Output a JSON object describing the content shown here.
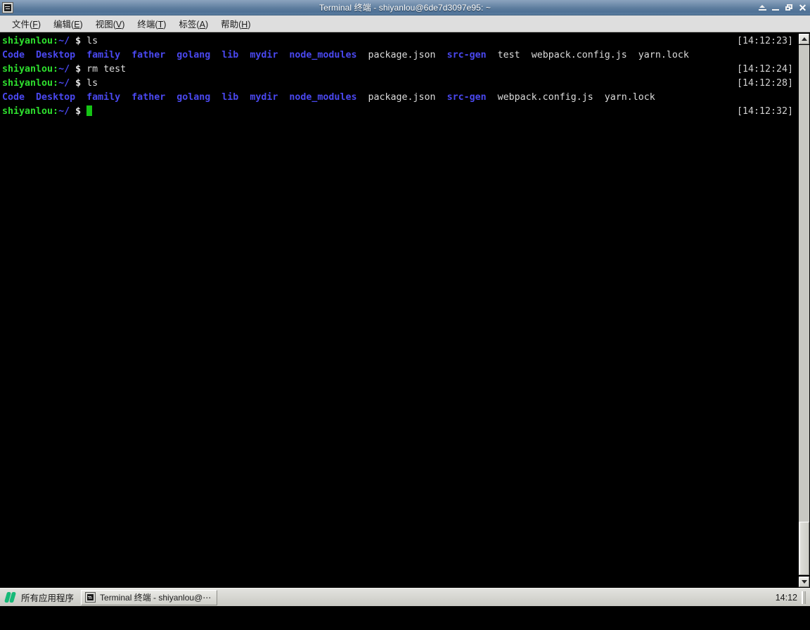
{
  "window": {
    "title": "Terminal 终端 - shiyanlou@6de7d3097e95: ~",
    "icon": "terminal-icon",
    "buttons": {
      "shade": "shade-window",
      "minimize": "minimize-window",
      "maximize": "maximize-window",
      "close": "✕"
    }
  },
  "menubar": {
    "items": [
      {
        "label": "文件",
        "accel": "F"
      },
      {
        "label": "编辑",
        "accel": "E"
      },
      {
        "label": "视图",
        "accel": "V"
      },
      {
        "label": "终端",
        "accel": "T"
      },
      {
        "label": "标签",
        "accel": "A"
      },
      {
        "label": "帮助",
        "accel": "H"
      }
    ]
  },
  "terminal": {
    "prompt_user": "shiyanlou:",
    "prompt_path": "~/",
    "prompt_sign": "$",
    "colors": {
      "background": "#000000",
      "green": "#2ee02e",
      "blue": "#4a48f0",
      "white": "#dcdcdc",
      "cursor": "#15c415"
    },
    "lines": [
      {
        "type": "command",
        "command": "ls",
        "timestamp": "[14:12:23]"
      },
      {
        "type": "output",
        "entries": [
          {
            "name": "Code",
            "kind": "dir"
          },
          {
            "name": "Desktop",
            "kind": "dir"
          },
          {
            "name": "family",
            "kind": "dir"
          },
          {
            "name": "father",
            "kind": "dir"
          },
          {
            "name": "golang",
            "kind": "dir"
          },
          {
            "name": "lib",
            "kind": "dir"
          },
          {
            "name": "mydir",
            "kind": "dir"
          },
          {
            "name": "node_modules",
            "kind": "dir"
          },
          {
            "name": "package.json",
            "kind": "file"
          },
          {
            "name": "src-gen",
            "kind": "dir"
          },
          {
            "name": "test",
            "kind": "file"
          },
          {
            "name": "webpack.config.js",
            "kind": "file"
          },
          {
            "name": "yarn.lock",
            "kind": "file"
          }
        ],
        "timestamp": ""
      },
      {
        "type": "command",
        "command": "rm test",
        "timestamp": "[14:12:24]"
      },
      {
        "type": "command",
        "command": "ls",
        "timestamp": "[14:12:28]"
      },
      {
        "type": "output",
        "entries": [
          {
            "name": "Code",
            "kind": "dir"
          },
          {
            "name": "Desktop",
            "kind": "dir"
          },
          {
            "name": "family",
            "kind": "dir"
          },
          {
            "name": "father",
            "kind": "dir"
          },
          {
            "name": "golang",
            "kind": "dir"
          },
          {
            "name": "lib",
            "kind": "dir"
          },
          {
            "name": "mydir",
            "kind": "dir"
          },
          {
            "name": "node_modules",
            "kind": "dir"
          },
          {
            "name": "package.json",
            "kind": "file"
          },
          {
            "name": "src-gen",
            "kind": "dir"
          },
          {
            "name": "webpack.config.js",
            "kind": "file"
          },
          {
            "name": "yarn.lock",
            "kind": "file"
          }
        ],
        "timestamp": ""
      },
      {
        "type": "prompt",
        "command": "",
        "timestamp": "[14:12:32]"
      }
    ]
  },
  "taskbar": {
    "app_menu_label": "所有应用程序",
    "app_menu_icon": "shiyanlou-logo-icon",
    "windows": [
      {
        "label": "Terminal 终端 - shiyanlou@⋯",
        "icon": "terminal-icon"
      }
    ],
    "clock": "14:12"
  }
}
